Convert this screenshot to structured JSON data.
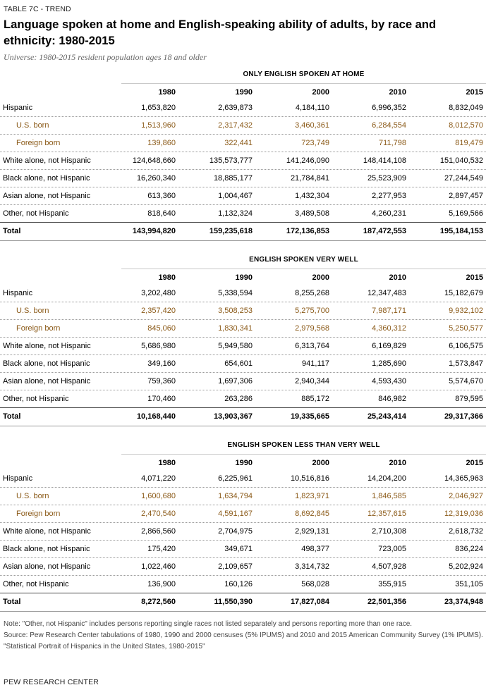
{
  "kicker": "TABLE 7C - TREND",
  "title": "Language spoken at home and English-speaking ability of adults, by race and ethnicity: 1980-2015",
  "subtitle": "Universe: 1980-2015 resident population ages 18 and older",
  "years": [
    "1980",
    "1990",
    "2000",
    "2010",
    "2015"
  ],
  "sections": [
    {
      "heading": "ONLY ENGLISH SPOKEN AT HOME",
      "rows": [
        {
          "label": "Hispanic",
          "values": [
            "1,653,820",
            "2,639,873",
            "4,184,110",
            "6,996,352",
            "8,832,049"
          ]
        },
        {
          "label": "U.S. born",
          "values": [
            "1,513,960",
            "2,317,432",
            "3,460,361",
            "6,284,554",
            "8,012,570"
          ]
        },
        {
          "label": "Foreign born",
          "values": [
            "139,860",
            "322,441",
            "723,749",
            "711,798",
            "819,479"
          ]
        },
        {
          "label": "White alone, not Hispanic",
          "values": [
            "124,648,660",
            "135,573,777",
            "141,246,090",
            "148,414,108",
            "151,040,532"
          ]
        },
        {
          "label": "Black alone, not Hispanic",
          "values": [
            "16,260,340",
            "18,885,177",
            "21,784,841",
            "25,523,909",
            "27,244,549"
          ]
        },
        {
          "label": "Asian alone, not Hispanic",
          "values": [
            "613,360",
            "1,004,467",
            "1,432,304",
            "2,277,953",
            "2,897,457"
          ]
        },
        {
          "label": "Other, not Hispanic",
          "values": [
            "818,640",
            "1,132,324",
            "3,489,508",
            "4,260,231",
            "5,169,566"
          ]
        },
        {
          "label": "Total",
          "values": [
            "143,994,820",
            "159,235,618",
            "172,136,853",
            "187,472,553",
            "195,184,153"
          ]
        }
      ]
    },
    {
      "heading": "ENGLISH SPOKEN VERY WELL",
      "rows": [
        {
          "label": "Hispanic",
          "values": [
            "3,202,480",
            "5,338,594",
            "8,255,268",
            "12,347,483",
            "15,182,679"
          ]
        },
        {
          "label": "U.S. born",
          "values": [
            "2,357,420",
            "3,508,253",
            "5,275,700",
            "7,987,171",
            "9,932,102"
          ]
        },
        {
          "label": "Foreign born",
          "values": [
            "845,060",
            "1,830,341",
            "2,979,568",
            "4,360,312",
            "5,250,577"
          ]
        },
        {
          "label": "White alone, not Hispanic",
          "values": [
            "5,686,980",
            "5,949,580",
            "6,313,764",
            "6,169,829",
            "6,106,575"
          ]
        },
        {
          "label": "Black alone, not Hispanic",
          "values": [
            "349,160",
            "654,601",
            "941,117",
            "1,285,690",
            "1,573,847"
          ]
        },
        {
          "label": "Asian alone, not Hispanic",
          "values": [
            "759,360",
            "1,697,306",
            "2,940,344",
            "4,593,430",
            "5,574,670"
          ]
        },
        {
          "label": "Other, not Hispanic",
          "values": [
            "170,460",
            "263,286",
            "885,172",
            "846,982",
            "879,595"
          ]
        },
        {
          "label": "Total",
          "values": [
            "10,168,440",
            "13,903,367",
            "19,335,665",
            "25,243,414",
            "29,317,366"
          ]
        }
      ]
    },
    {
      "heading": "ENGLISH SPOKEN LESS THAN VERY WELL",
      "rows": [
        {
          "label": "Hispanic",
          "values": [
            "4,071,220",
            "6,225,961",
            "10,516,816",
            "14,204,200",
            "14,365,963"
          ]
        },
        {
          "label": "U.S. born",
          "values": [
            "1,600,680",
            "1,634,794",
            "1,823,971",
            "1,846,585",
            "2,046,927"
          ]
        },
        {
          "label": "Foreign born",
          "values": [
            "2,470,540",
            "4,591,167",
            "8,692,845",
            "12,357,615",
            "12,319,036"
          ]
        },
        {
          "label": "White alone, not Hispanic",
          "values": [
            "2,866,560",
            "2,704,975",
            "2,929,131",
            "2,710,308",
            "2,618,732"
          ]
        },
        {
          "label": "Black alone, not Hispanic",
          "values": [
            "175,420",
            "349,671",
            "498,377",
            "723,005",
            "836,224"
          ]
        },
        {
          "label": "Asian alone, not Hispanic",
          "values": [
            "1,022,460",
            "2,109,657",
            "3,314,732",
            "4,507,928",
            "5,202,924"
          ]
        },
        {
          "label": "Other, not Hispanic",
          "values": [
            "136,900",
            "160,126",
            "568,028",
            "355,915",
            "351,105"
          ]
        },
        {
          "label": "Total",
          "values": [
            "8,272,560",
            "11,550,390",
            "17,827,084",
            "22,501,356",
            "23,374,948"
          ]
        }
      ]
    }
  ],
  "notes": [
    "Note: \"Other, not Hispanic\" includes persons reporting single races not listed separately and persons reporting more than one race.",
    "Source: Pew Research Center tabulations of 1980, 1990 and 2000 censuses (5% IPUMS) and 2010 and 2015 American Community Survey (1% IPUMS).",
    "\"Statistical Portrait of Hispanics in the United States, 1980-2015\""
  ],
  "brand": "PEW RESEARCH CENTER"
}
